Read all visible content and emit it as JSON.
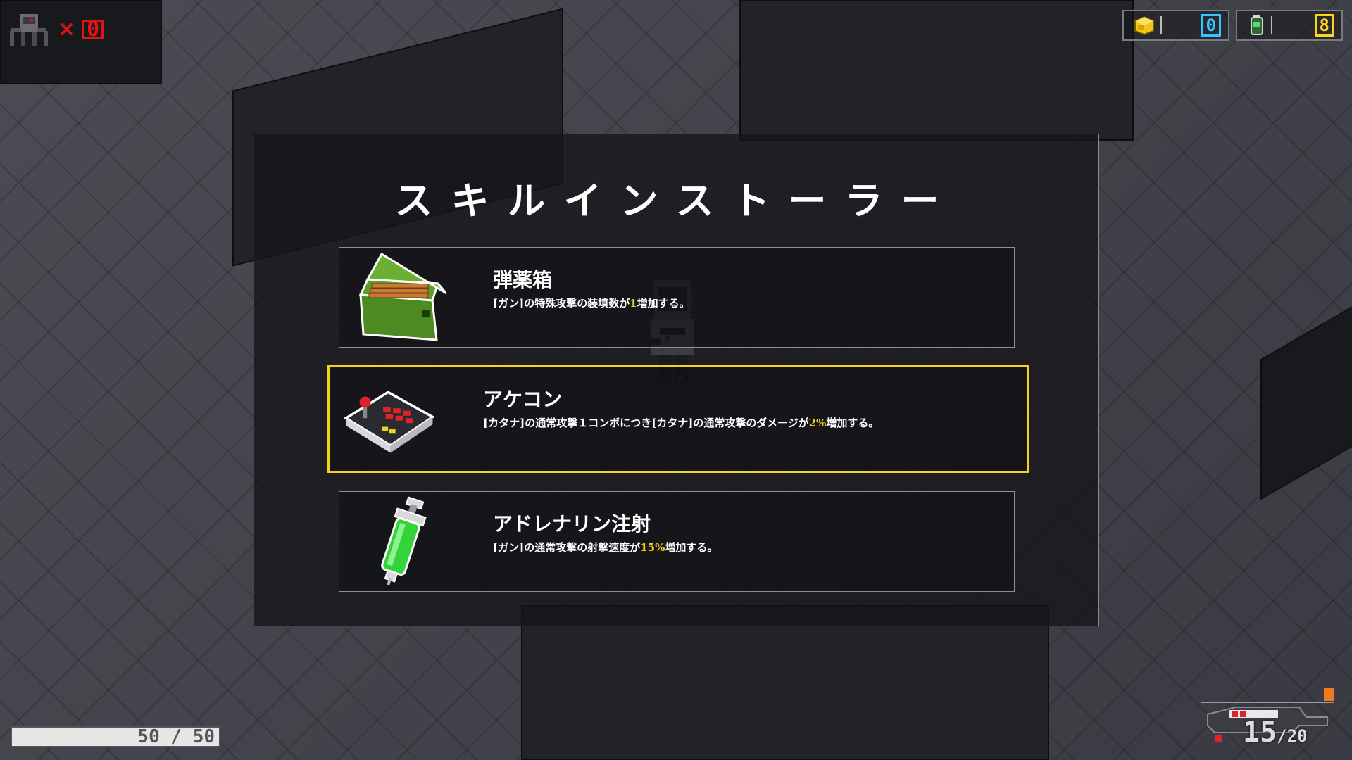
{
  "hud": {
    "enemy_icon": "spider-robot-icon",
    "enemy_multiplier": "×",
    "enemy_count": "0",
    "resources": [
      {
        "icon": "yellow-cube-icon",
        "value": "0",
        "color": "#35c4ff"
      },
      {
        "icon": "green-can-icon",
        "value": "8",
        "color": "#ffd21a"
      }
    ],
    "hp": {
      "current": 50,
      "max": 50,
      "text": "50 / 50"
    },
    "weapon": {
      "icon": "rifle-icon",
      "ammo_current": "15",
      "ammo_max": "/20"
    }
  },
  "modal": {
    "title": "スキルインストーラー",
    "accent_color": "#f2d31e",
    "skills": [
      {
        "icon": "ammo-box-icon",
        "name": "弾薬箱",
        "desc_before": "[ガン]の特殊攻撃の装填数が",
        "desc_highlight": "1",
        "desc_after": "増加する。",
        "selected": false
      },
      {
        "icon": "arcade-controller-icon",
        "name": "アケコン",
        "desc_before": "[カタナ]の通常攻撃１コンボにつき[カタナ]の通常攻撃のダメージが",
        "desc_highlight": "2%",
        "desc_after": "増加する。",
        "selected": true
      },
      {
        "icon": "adrenaline-syringe-icon",
        "name": "アドレナリン注射",
        "desc_before": "[ガン]の通常攻撃の射撃速度が",
        "desc_highlight": "15%",
        "desc_after": "増加する。",
        "selected": false
      }
    ]
  }
}
